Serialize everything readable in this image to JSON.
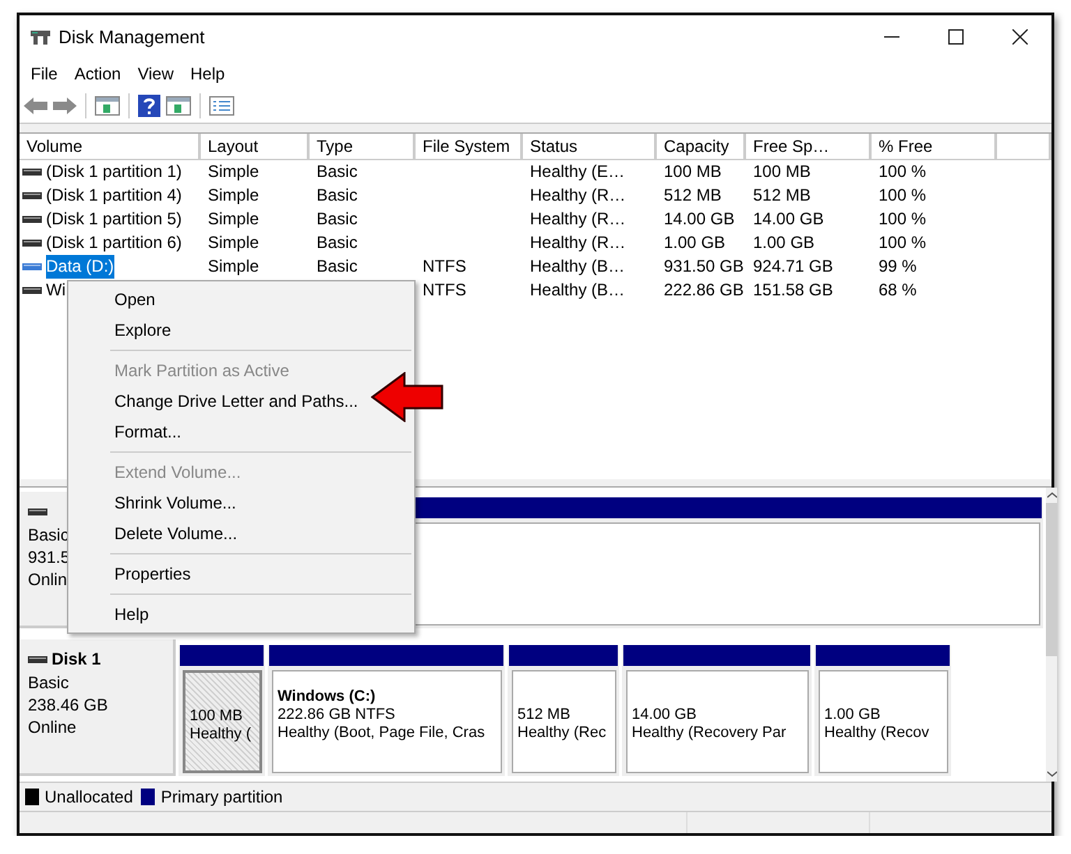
{
  "window": {
    "title": "Disk Management"
  },
  "menubar": [
    "File",
    "Action",
    "View",
    "Help"
  ],
  "table": {
    "columns": [
      "Volume",
      "Layout",
      "Type",
      "File System",
      "Status",
      "Capacity",
      "Free Sp…",
      "% Free"
    ],
    "rows": [
      {
        "selected": false,
        "cells": [
          "(Disk 1 partition 1)",
          "Simple",
          "Basic",
          null,
          "Healthy (E…",
          "100 MB",
          "100 MB",
          "100 %"
        ]
      },
      {
        "selected": false,
        "cells": [
          "(Disk 1 partition 4)",
          "Simple",
          "Basic",
          null,
          "Healthy (R…",
          "512 MB",
          "512 MB",
          "100 %"
        ]
      },
      {
        "selected": false,
        "cells": [
          "(Disk 1 partition 5)",
          "Simple",
          "Basic",
          null,
          "Healthy (R…",
          "14.00 GB",
          "14.00 GB",
          "100 %"
        ]
      },
      {
        "selected": false,
        "cells": [
          "(Disk 1 partition 6)",
          "Simple",
          "Basic",
          null,
          "Healthy (R…",
          "1.00 GB",
          "1.00 GB",
          "100 %"
        ]
      },
      {
        "selected": true,
        "cells": [
          "Data (D:)",
          "Simple",
          "Basic",
          "NTFS",
          "Healthy (B…",
          "931.50 GB",
          "924.71 GB",
          "99 %"
        ]
      },
      {
        "selected": false,
        "cells": [
          "Wi",
          null,
          null,
          "NTFS",
          "Healthy (B…",
          "222.86 GB",
          "151.58 GB",
          "68 %"
        ]
      }
    ]
  },
  "disks": [
    {
      "info": [
        "Basic",
        "931.5",
        "Onlin"
      ],
      "partitions": [
        {
          "selected": false
        }
      ]
    },
    {
      "name": "Disk 1",
      "info": [
        "Basic",
        "238.46 GB",
        "Online"
      ],
      "partitions": [
        {
          "selected": true,
          "lines": [
            "100 MB",
            "Healthy ("
          ]
        },
        {
          "selected": false,
          "title": "Windows  (C:)",
          "lines": [
            "222.86 GB NTFS",
            "Healthy (Boot, Page File, Cras"
          ]
        },
        {
          "selected": false,
          "lines": [
            "512 MB",
            "Healthy (Rec"
          ]
        },
        {
          "selected": false,
          "lines": [
            "14.00 GB",
            "Healthy (Recovery Par"
          ]
        },
        {
          "selected": false,
          "lines": [
            "1.00 GB",
            "Healthy (Recov"
          ]
        }
      ]
    }
  ],
  "legend": [
    {
      "label": "Unallocated",
      "color": "#000000"
    },
    {
      "label": "Primary partition",
      "color": "#000080"
    }
  ],
  "context_menu": {
    "items": [
      {
        "kind": "item",
        "label": "Open",
        "disabled": false
      },
      {
        "kind": "item",
        "label": "Explore",
        "disabled": false
      },
      {
        "kind": "separator"
      },
      {
        "kind": "item",
        "label": "Mark Partition as Active",
        "disabled": true
      },
      {
        "kind": "item",
        "label": "Change Drive Letter and Paths...",
        "disabled": false
      },
      {
        "kind": "item",
        "label": "Format...",
        "disabled": false
      },
      {
        "kind": "separator"
      },
      {
        "kind": "item",
        "label": "Extend Volume...",
        "disabled": true
      },
      {
        "kind": "item",
        "label": "Shrink Volume...",
        "disabled": false
      },
      {
        "kind": "item",
        "label": "Delete Volume...",
        "disabled": false
      },
      {
        "kind": "separator"
      },
      {
        "kind": "item",
        "label": "Properties",
        "disabled": false
      },
      {
        "kind": "separator"
      },
      {
        "kind": "item",
        "label": "Help",
        "disabled": false
      }
    ]
  }
}
